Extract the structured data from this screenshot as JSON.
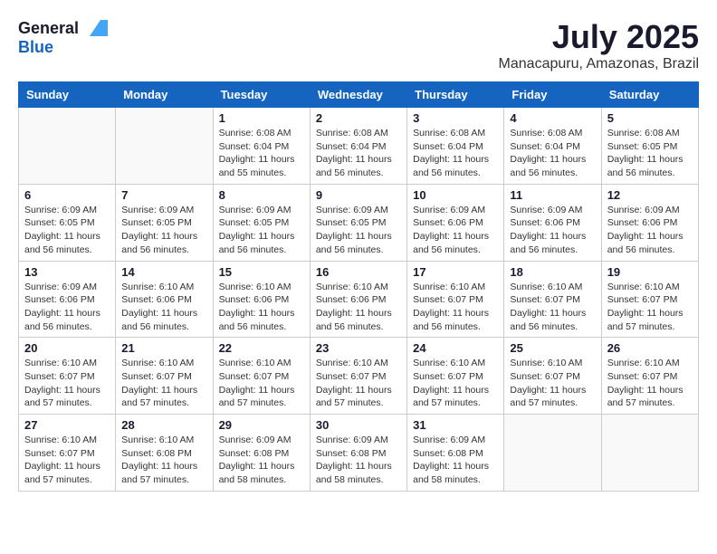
{
  "logo": {
    "general": "General",
    "blue": "Blue"
  },
  "title": {
    "month_year": "July 2025",
    "location": "Manacapuru, Amazonas, Brazil"
  },
  "headers": [
    "Sunday",
    "Monday",
    "Tuesday",
    "Wednesday",
    "Thursday",
    "Friday",
    "Saturday"
  ],
  "weeks": [
    [
      {
        "day": "",
        "info": ""
      },
      {
        "day": "",
        "info": ""
      },
      {
        "day": "1",
        "info": "Sunrise: 6:08 AM\nSunset: 6:04 PM\nDaylight: 11 hours and 55 minutes."
      },
      {
        "day": "2",
        "info": "Sunrise: 6:08 AM\nSunset: 6:04 PM\nDaylight: 11 hours and 56 minutes."
      },
      {
        "day": "3",
        "info": "Sunrise: 6:08 AM\nSunset: 6:04 PM\nDaylight: 11 hours and 56 minutes."
      },
      {
        "day": "4",
        "info": "Sunrise: 6:08 AM\nSunset: 6:04 PM\nDaylight: 11 hours and 56 minutes."
      },
      {
        "day": "5",
        "info": "Sunrise: 6:08 AM\nSunset: 6:05 PM\nDaylight: 11 hours and 56 minutes."
      }
    ],
    [
      {
        "day": "6",
        "info": "Sunrise: 6:09 AM\nSunset: 6:05 PM\nDaylight: 11 hours and 56 minutes."
      },
      {
        "day": "7",
        "info": "Sunrise: 6:09 AM\nSunset: 6:05 PM\nDaylight: 11 hours and 56 minutes."
      },
      {
        "day": "8",
        "info": "Sunrise: 6:09 AM\nSunset: 6:05 PM\nDaylight: 11 hours and 56 minutes."
      },
      {
        "day": "9",
        "info": "Sunrise: 6:09 AM\nSunset: 6:05 PM\nDaylight: 11 hours and 56 minutes."
      },
      {
        "day": "10",
        "info": "Sunrise: 6:09 AM\nSunset: 6:06 PM\nDaylight: 11 hours and 56 minutes."
      },
      {
        "day": "11",
        "info": "Sunrise: 6:09 AM\nSunset: 6:06 PM\nDaylight: 11 hours and 56 minutes."
      },
      {
        "day": "12",
        "info": "Sunrise: 6:09 AM\nSunset: 6:06 PM\nDaylight: 11 hours and 56 minutes."
      }
    ],
    [
      {
        "day": "13",
        "info": "Sunrise: 6:09 AM\nSunset: 6:06 PM\nDaylight: 11 hours and 56 minutes."
      },
      {
        "day": "14",
        "info": "Sunrise: 6:10 AM\nSunset: 6:06 PM\nDaylight: 11 hours and 56 minutes."
      },
      {
        "day": "15",
        "info": "Sunrise: 6:10 AM\nSunset: 6:06 PM\nDaylight: 11 hours and 56 minutes."
      },
      {
        "day": "16",
        "info": "Sunrise: 6:10 AM\nSunset: 6:06 PM\nDaylight: 11 hours and 56 minutes."
      },
      {
        "day": "17",
        "info": "Sunrise: 6:10 AM\nSunset: 6:07 PM\nDaylight: 11 hours and 56 minutes."
      },
      {
        "day": "18",
        "info": "Sunrise: 6:10 AM\nSunset: 6:07 PM\nDaylight: 11 hours and 56 minutes."
      },
      {
        "day": "19",
        "info": "Sunrise: 6:10 AM\nSunset: 6:07 PM\nDaylight: 11 hours and 57 minutes."
      }
    ],
    [
      {
        "day": "20",
        "info": "Sunrise: 6:10 AM\nSunset: 6:07 PM\nDaylight: 11 hours and 57 minutes."
      },
      {
        "day": "21",
        "info": "Sunrise: 6:10 AM\nSunset: 6:07 PM\nDaylight: 11 hours and 57 minutes."
      },
      {
        "day": "22",
        "info": "Sunrise: 6:10 AM\nSunset: 6:07 PM\nDaylight: 11 hours and 57 minutes."
      },
      {
        "day": "23",
        "info": "Sunrise: 6:10 AM\nSunset: 6:07 PM\nDaylight: 11 hours and 57 minutes."
      },
      {
        "day": "24",
        "info": "Sunrise: 6:10 AM\nSunset: 6:07 PM\nDaylight: 11 hours and 57 minutes."
      },
      {
        "day": "25",
        "info": "Sunrise: 6:10 AM\nSunset: 6:07 PM\nDaylight: 11 hours and 57 minutes."
      },
      {
        "day": "26",
        "info": "Sunrise: 6:10 AM\nSunset: 6:07 PM\nDaylight: 11 hours and 57 minutes."
      }
    ],
    [
      {
        "day": "27",
        "info": "Sunrise: 6:10 AM\nSunset: 6:07 PM\nDaylight: 11 hours and 57 minutes."
      },
      {
        "day": "28",
        "info": "Sunrise: 6:10 AM\nSunset: 6:08 PM\nDaylight: 11 hours and 57 minutes."
      },
      {
        "day": "29",
        "info": "Sunrise: 6:09 AM\nSunset: 6:08 PM\nDaylight: 11 hours and 58 minutes."
      },
      {
        "day": "30",
        "info": "Sunrise: 6:09 AM\nSunset: 6:08 PM\nDaylight: 11 hours and 58 minutes."
      },
      {
        "day": "31",
        "info": "Sunrise: 6:09 AM\nSunset: 6:08 PM\nDaylight: 11 hours and 58 minutes."
      },
      {
        "day": "",
        "info": ""
      },
      {
        "day": "",
        "info": ""
      }
    ]
  ]
}
